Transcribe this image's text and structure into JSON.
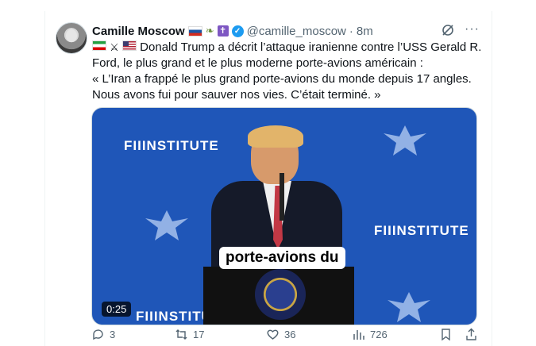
{
  "tweet": {
    "author_name": "Camille Moscow",
    "handle": "@camille_moscow",
    "separator": "·",
    "time": "8m",
    "more_label": "···",
    "text_lines": [
      "Donald Trump a décrit l’attaque iranienne contre l’USS Gerald R.",
      "Ford, le plus grand et le plus moderne porte-avions américain :",
      "« L’Iran a frappé le plus grand porte-avions du monde depuis 17 angles.",
      "Nous avons fui pour sauver nos vies. C’était terminé. »"
    ]
  },
  "media": {
    "logo_text_1": "FIIINSTITUTE",
    "logo_text_2": "FIIINSTITUTE",
    "logo_text_3": "FIIINSTITUT",
    "caption": "porte-avions du",
    "duration": "0:25"
  },
  "actions": {
    "replies": "3",
    "reposts": "17",
    "likes": "36",
    "views": "726"
  },
  "colors": {
    "accent": "#1d9bf0",
    "video_bg": "#1f56b8",
    "text": "#0f1419",
    "muted": "#536471"
  }
}
